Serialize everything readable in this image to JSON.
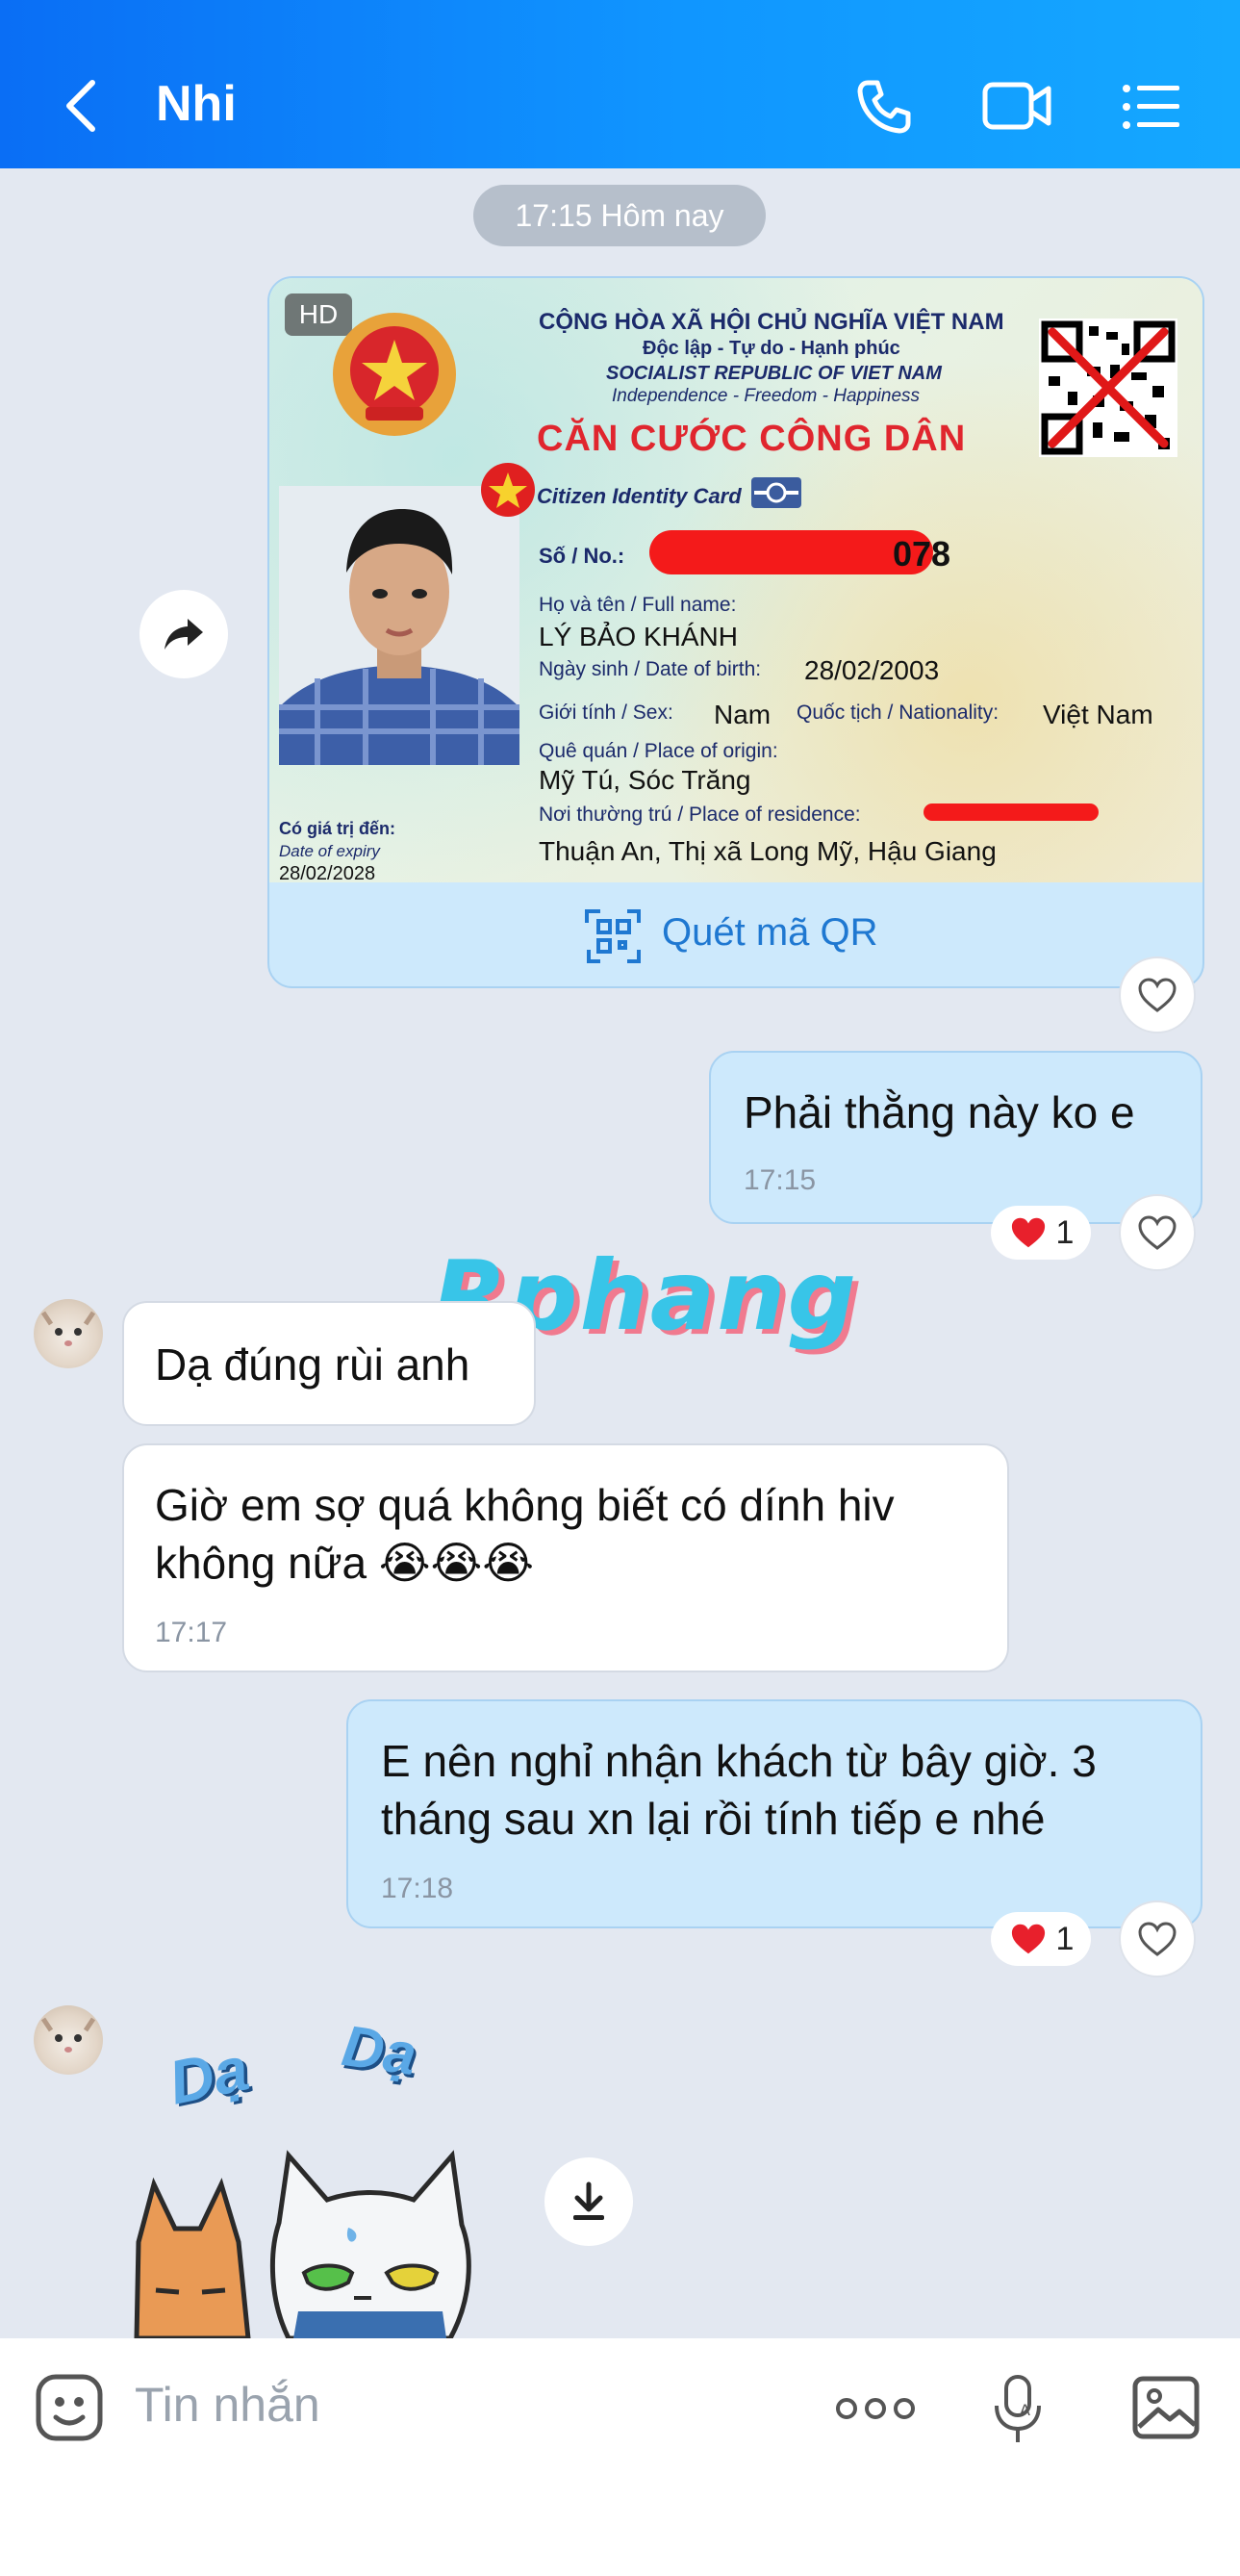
{
  "header": {
    "title": "Nhi",
    "icons": [
      "back-arrow-icon",
      "phone-icon",
      "video-call-icon",
      "menu-list-icon"
    ]
  },
  "time_divider": "17:15 Hôm nay",
  "id_card": {
    "hd_badge": "HD",
    "line1": "CỘNG HÒA XÃ HỘI CHỦ NGHĨA VIỆT NAM",
    "line2": "Độc lập - Tự do - Hạnh phúc",
    "line3": "SOCIALIST REPUBLIC OF VIET NAM",
    "line4": "Independence - Freedom - Happiness",
    "heading": "CĂN CƯỚC CÔNG DÂN",
    "subheading": "Citizen Identity Card",
    "number_label": "Số / No.:",
    "number_visible": "078",
    "name_label": "Họ và tên / Full name:",
    "name": "LÝ BẢO KHÁNH",
    "dob_label": "Ngày sinh / Date of birth:",
    "dob": "28/02/2003",
    "sex_label": "Giới tính / Sex:",
    "sex": "Nam",
    "nationality_label": "Quốc tịch / Nationality:",
    "nationality": "Việt Nam",
    "origin_label": "Quê quán / Place of origin:",
    "origin": "Mỹ Tú, Sóc Trăng",
    "residence_label": "Nơi thường trú / Place of residence:",
    "residence": "Thuận An, Thị xã Long Mỹ, Hậu Giang",
    "expiry_label": "Có giá trị đến:",
    "expiry_label_en": "Date of expiry",
    "expiry": "28/02/2028",
    "qr_button": "Quét mã QR"
  },
  "messages": [
    {
      "side": "me",
      "text": "Phải thằng này ko e",
      "time": "17:15",
      "reaction_count": "1"
    },
    {
      "side": "them",
      "text": "Dạ đúng rùi anh"
    },
    {
      "side": "them",
      "text": "Giờ em sợ quá không biết có dính hiv không nữa 😭😭😭",
      "time": "17:17"
    },
    {
      "side": "me",
      "text": "E nên nghỉ nhận khách từ bây giờ. 3 tháng sau xn lại rồi tính tiếp e nhé",
      "time": "17:18",
      "reaction_count": "1"
    }
  ],
  "sticker": {
    "text1": "Dạ",
    "text2": "Dạ"
  },
  "watermark": "Rphang",
  "input": {
    "placeholder": "Tin nhắn"
  },
  "colors": {
    "header": "#0a6ef5",
    "my_bubble": "#cde9fc",
    "their_bubble": "#ffffff",
    "background": "#e3e8f1",
    "link": "#1f78d1"
  }
}
